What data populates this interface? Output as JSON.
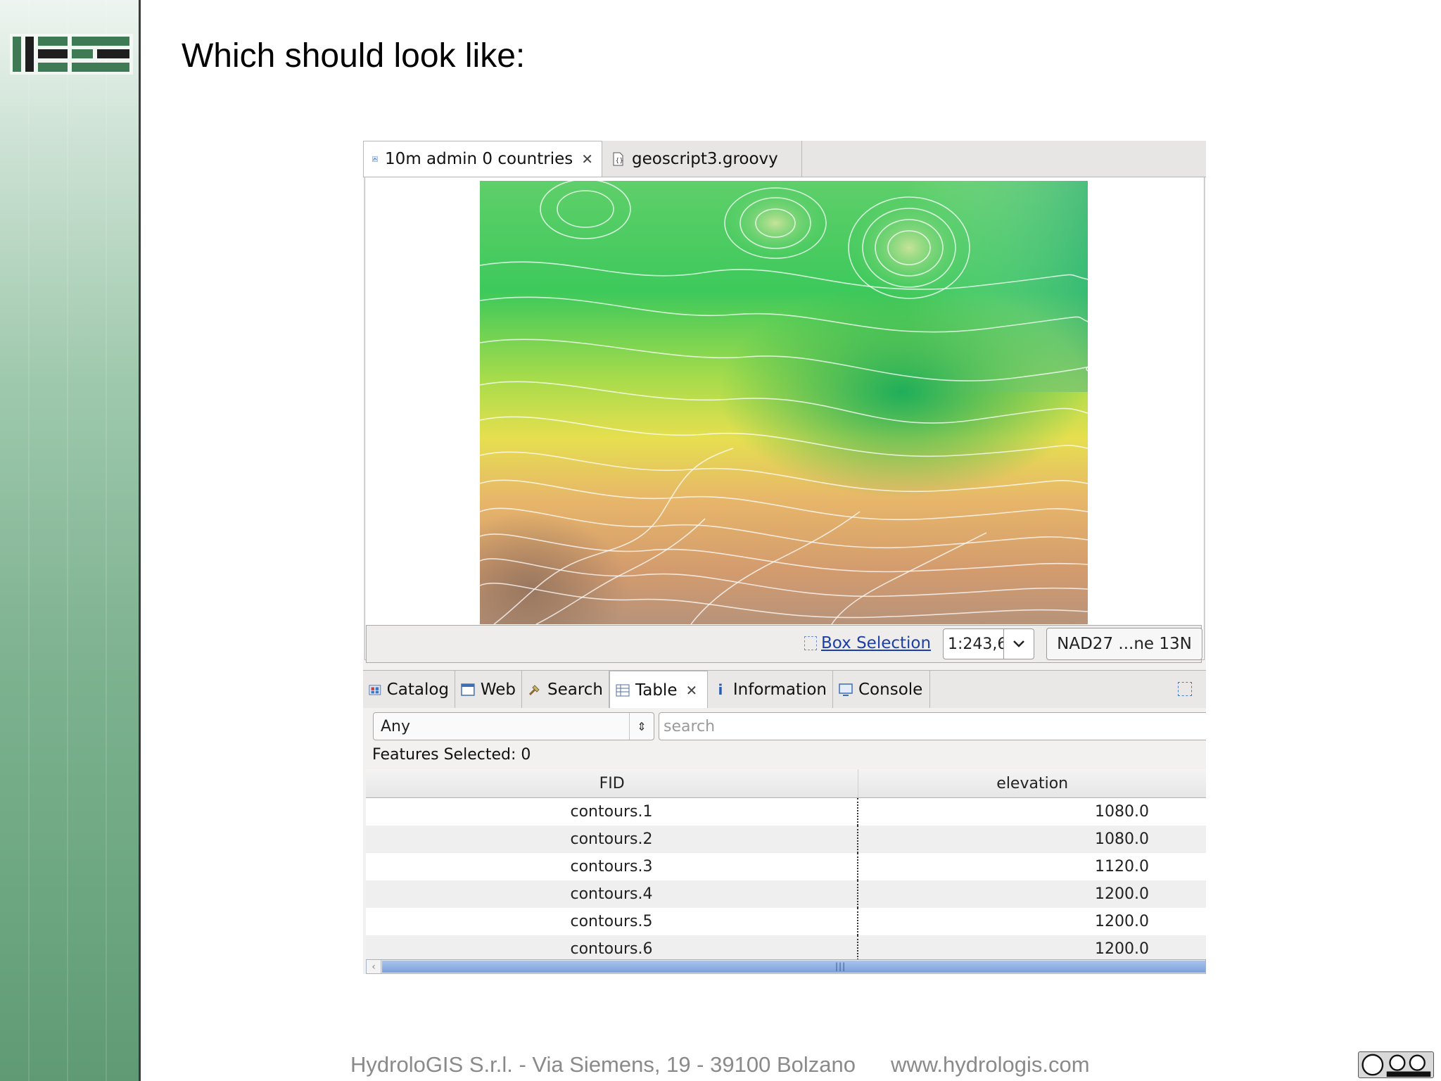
{
  "slide": {
    "title": "Which should look like:",
    "footer_company": "HydroloGIS S.r.l. - Via Siemens, 19 - 39100 Bolzano",
    "footer_website": "www.hydrologis.com"
  },
  "editor_tabs": [
    {
      "label": "10m admin 0 countries",
      "icon": "map-icon",
      "closable": true,
      "active": true
    },
    {
      "label": "geoscript3.groovy",
      "icon": "script-file-icon",
      "closable": false,
      "active": false
    }
  ],
  "map_status": {
    "box_selection_label": "Box Selection",
    "scale_value": "1:243,6",
    "crs_label": "NAD27 ...ne 13N"
  },
  "view_tabs": [
    {
      "label": "Catalog",
      "icon": "catalog-icon"
    },
    {
      "label": "Web",
      "icon": "web-icon"
    },
    {
      "label": "Search",
      "icon": "search-icon"
    },
    {
      "label": "Table",
      "icon": "table-icon",
      "closable": true,
      "active": true
    },
    {
      "label": "Information",
      "icon": "info-icon"
    },
    {
      "label": "Console",
      "icon": "console-icon"
    }
  ],
  "filter": {
    "attribute_select": "Any",
    "search_placeholder": "search"
  },
  "features_selected": "Features Selected: 0",
  "table": {
    "columns": [
      "FID",
      "elevation"
    ],
    "rows": [
      [
        "contours.1",
        "1080.0"
      ],
      [
        "contours.2",
        "1080.0"
      ],
      [
        "contours.3",
        "1120.0"
      ],
      [
        "contours.4",
        "1200.0"
      ],
      [
        "contours.5",
        "1200.0"
      ],
      [
        "contours.6",
        "1200.0"
      ]
    ]
  },
  "colors": {
    "accent_green": "#3e7a54",
    "link_blue": "#1a3fa8",
    "scrollbar_blue": "#7aa0dc"
  }
}
